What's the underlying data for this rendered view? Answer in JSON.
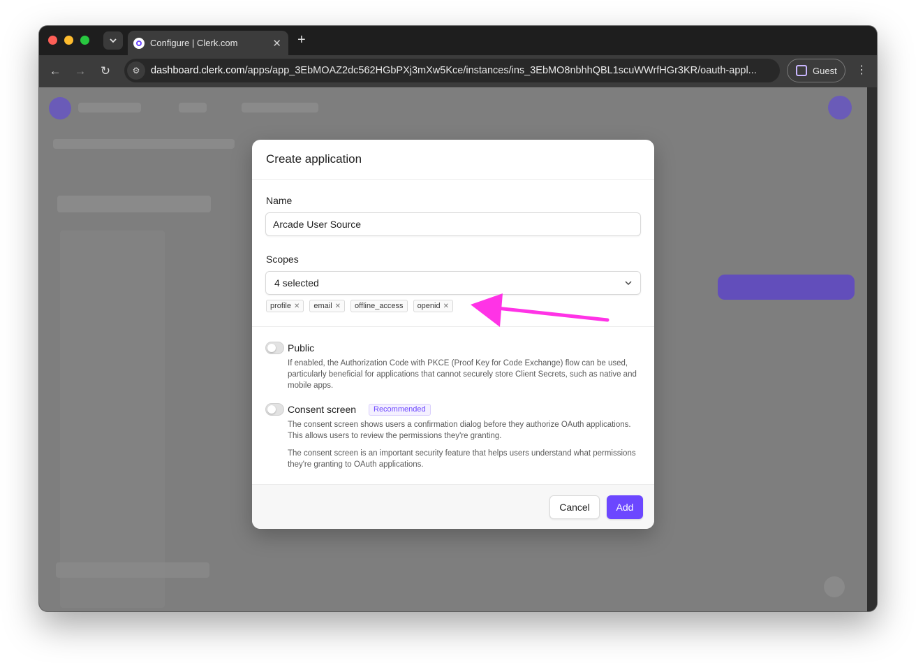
{
  "browser": {
    "tab_title": "Configure | Clerk.com",
    "url_host": "dashboard.clerk.com",
    "url_path": "/apps/app_3EbMOAZ2dc562HGbPXj3mXw5Kce/instances/ins_3EbMO8nbhhQBL1scuWWrfHGr3KR/oauth-appl...",
    "profile_label": "Guest"
  },
  "modal": {
    "title": "Create application",
    "name_label": "Name",
    "name_value": "Arcade User Source",
    "scopes_label": "Scopes",
    "scopes_selected": "4 selected",
    "scopes": [
      "profile",
      "email",
      "offline_access",
      "openid"
    ],
    "public": {
      "title": "Public",
      "description": "If enabled, the Authorization Code with PKCE (Proof Key for Code Exchange) flow can be used, particularly beneficial for applications that cannot securely store Client Secrets, such as native and mobile apps."
    },
    "consent": {
      "title": "Consent screen",
      "badge": "Recommended",
      "description_1": "The consent screen shows users a confirmation dialog before they authorize OAuth applications. This allows users to review the permissions they're granting.",
      "description_2": "The consent screen is an important security feature that helps users understand what permissions they're granting to OAuth applications."
    },
    "cancel_label": "Cancel",
    "add_label": "Add"
  },
  "colors": {
    "accent": "#6c47ff",
    "annotation_arrow": "#ff33e6"
  }
}
